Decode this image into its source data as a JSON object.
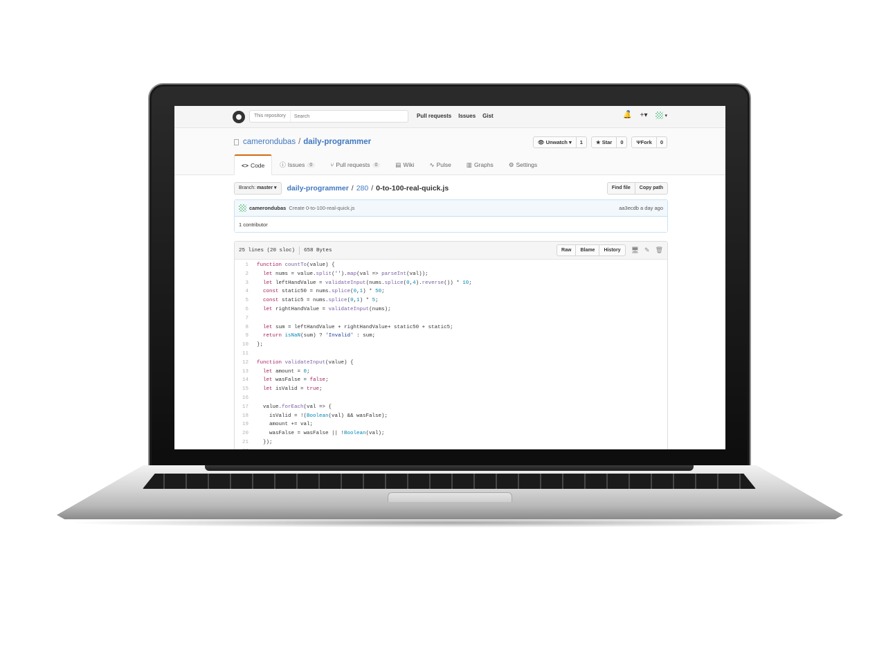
{
  "header": {
    "search_scope": "This repository",
    "search_placeholder": "Search",
    "nav": [
      "Pull requests",
      "Issues",
      "Gist"
    ],
    "plus_label": "+▾",
    "avatar_caret": "▾"
  },
  "repo": {
    "owner": "camerondubas",
    "separator": "/",
    "name": "daily-programmer",
    "actions": [
      {
        "label": "Unwatch ▾",
        "count": "1",
        "icon": "eye-icon"
      },
      {
        "label": "Star",
        "count": "0",
        "icon": "star-icon"
      },
      {
        "label": "Fork",
        "count": "0",
        "icon": "fork-icon"
      }
    ],
    "tabs": [
      {
        "label": "Code",
        "icon": "code-icon",
        "selected": true,
        "counter": ""
      },
      {
        "label": "Issues",
        "icon": "issue-icon",
        "counter": "0"
      },
      {
        "label": "Pull requests",
        "icon": "pull-request-icon",
        "counter": "0"
      },
      {
        "label": "Wiki",
        "icon": "book-icon",
        "counter": ""
      },
      {
        "label": "Pulse",
        "icon": "pulse-icon",
        "counter": ""
      },
      {
        "label": "Graphs",
        "icon": "graph-icon",
        "counter": ""
      },
      {
        "label": "Settings",
        "icon": "gear-icon",
        "counter": ""
      }
    ]
  },
  "file_nav": {
    "branch_prefix": "Branch:",
    "branch": "master ▾",
    "breadcrumb_repo": "daily-programmer",
    "breadcrumb_dir": "280",
    "breadcrumb_file": "0-to-100-real-quick.js",
    "sep": "/",
    "find_file": "Find file",
    "copy_path": "Copy path"
  },
  "commit": {
    "author": "camerondubas",
    "message": "Create 0-to-100-real-quick.js",
    "meta": "aa3ecdb a day ago",
    "contributors": "1 contributor"
  },
  "file": {
    "lines_info": "25 lines (20 sloc)",
    "size": "658 Bytes",
    "buttons": [
      "Raw",
      "Blame",
      "History"
    ],
    "code": [
      "function countTo(value) {",
      "  let nums = value.split('').map(val => parseInt(val));",
      "  let leftHandValue = validateInput(nums.splice(0,4).reverse()) * 10;",
      "  const static50 = nums.splice(0,1) * 50;",
      "  const static5 = nums.splice(0,1) * 5;",
      "  let rightHandValue = validateInput(nums);",
      "",
      "  let sum = leftHandValue + rightHandValue+ static50 + static5;",
      "  return isNaN(sum) ? 'Invalid' : sum;",
      "};",
      "",
      "function validateInput(value) {",
      "  let amount = 0;",
      "  let wasFalse = false;",
      "  let isValid = true;",
      "",
      "  value.forEach(val => {",
      "    isValid = !(Boolean(val) && wasFalse);",
      "    amount += val;",
      "    wasFalse = wasFalse || !Boolean(val);",
      "  });",
      ""
    ]
  }
}
